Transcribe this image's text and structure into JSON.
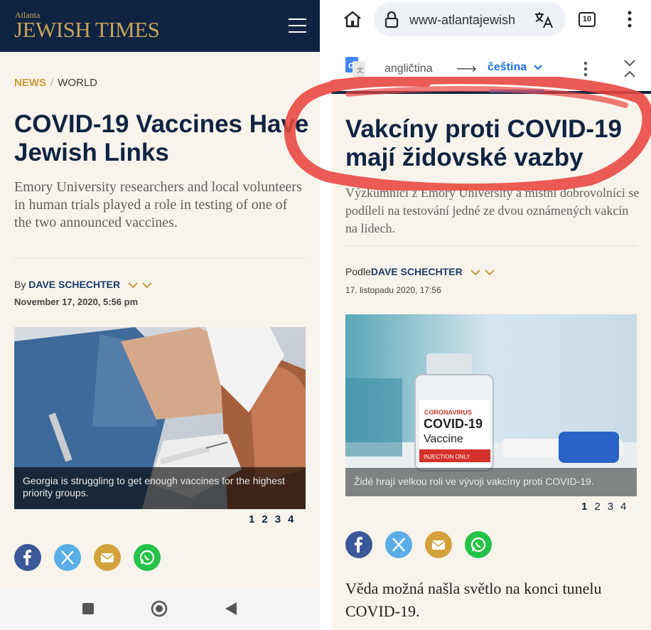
{
  "left": {
    "logo": {
      "small": "Atlanta",
      "big": "JEWISH TIMES"
    },
    "breadcrumb": {
      "section": "NEWS",
      "separator": "/",
      "subsection": "WORLD"
    },
    "title": "COVID-19 Vaccines Have Jewish Links",
    "subtitle": "Emory University researchers and local volunteers in human trials played a role in testing of one of the two announced vaccines.",
    "byline": {
      "prefix": "By",
      "author": "DAVE SCHECHTER",
      "chevrons": "⌄ ⌄"
    },
    "date": "November 17, 2020, 5:56 pm",
    "photo_caption": "Georgia is struggling to get enough vaccines for the highest priority groups.",
    "pager": [
      "1",
      "2",
      "3",
      "4"
    ],
    "share_icons": [
      "facebook-icon",
      "x-icon",
      "email-icon",
      "whatsapp-icon"
    ]
  },
  "right": {
    "browser": {
      "url": "www-atlantajewish",
      "tab_count": "10"
    },
    "translate": {
      "source_lang": "angličtina",
      "arrow": "⟶",
      "target_lang": "čeština"
    },
    "title": "Vakcíny proti COVID-19 mají židovské vazby",
    "subtitle": "Výzkumníci z Emory University a místní dobrovolníci se podíleli na testování jedné ze dvou oznámených vakcín na lidech.",
    "byline": {
      "prefix": "Podle",
      "author": "DAVE SCHECHTER",
      "chevrons": "⌄ ⌄"
    },
    "date": "17. listopadu 2020, 17:56",
    "vial": {
      "line1": "CORONAVIRUS",
      "line2": "COVID-19",
      "line3": "Vaccine",
      "line4": "INJECTION ONLY"
    },
    "photo_caption": "Židé hrají velkou roli ve vývoji vakcíny proti COVID-19.",
    "pager": [
      "1",
      "2",
      "3",
      "4"
    ],
    "body": "Věda možná našla světlo na konci tunelu COVID-19."
  },
  "colors": {
    "navy": "#0f2442",
    "gold": "#c8993c",
    "background": "#f8f4ec",
    "highlight_red": "#e8443e",
    "facebook": "#3b5998",
    "x": "#5aaee8",
    "email": "#d4a23c",
    "whatsapp": "#25c24a"
  }
}
